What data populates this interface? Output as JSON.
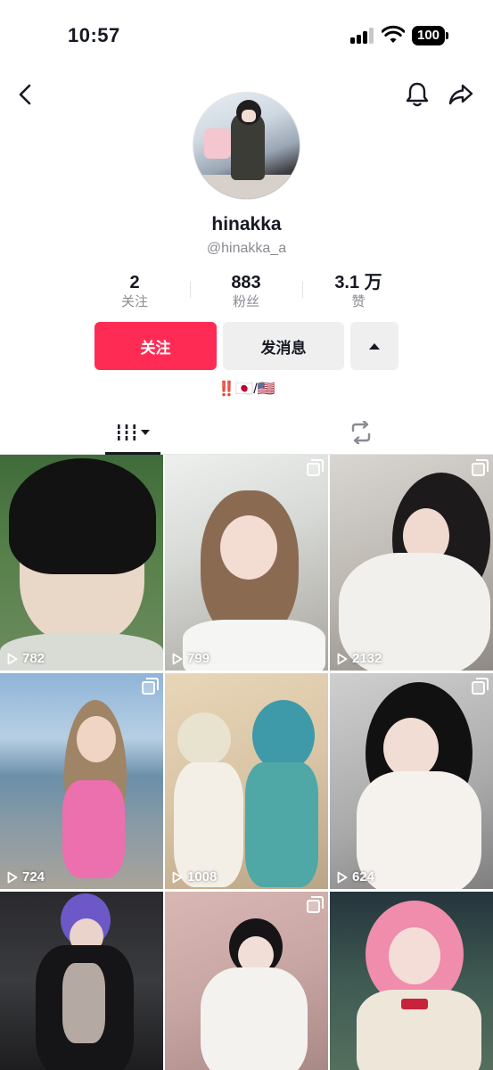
{
  "status_bar": {
    "time": "10:57",
    "battery": "100"
  },
  "profile": {
    "display_name": "hinakka",
    "handle": "@hinakka_a",
    "bio": {
      "emphasis": "‼️",
      "flags": "🇯🇵/🇺🇸"
    }
  },
  "stats": {
    "following": {
      "value": "2",
      "label": "关注"
    },
    "followers": {
      "value": "883",
      "label": "粉丝"
    },
    "likes": {
      "value": "3.1 万",
      "label": "赞"
    }
  },
  "actions": {
    "follow_label": "关注",
    "message_label": "发消息"
  },
  "tabs": {
    "active": "videos"
  },
  "videos": [
    {
      "views": "782",
      "multi_photo": false,
      "theme": "anime portrait"
    },
    {
      "views": "799",
      "multi_photo": true,
      "theme": "bunny nurse cosplay"
    },
    {
      "views": "2132",
      "multi_photo": true,
      "theme": "white dress cosplay"
    },
    {
      "views": "724",
      "multi_photo": true,
      "theme": "beach cosplay"
    },
    {
      "views": "1008",
      "multi_photo": false,
      "theme": "duo cosplay"
    },
    {
      "views": "624",
      "multi_photo": true,
      "theme": "cat ear cosplay"
    },
    {
      "views": "",
      "multi_photo": false,
      "theme": "purple hair cosplay"
    },
    {
      "views": "",
      "multi_photo": true,
      "theme": "blossom cosplay"
    },
    {
      "views": "",
      "multi_photo": false,
      "theme": "pink hair cosplay"
    }
  ],
  "colors": {
    "accent": "#fe2c55",
    "secondary_button": "#efefef",
    "muted_text": "#8a8b91"
  }
}
